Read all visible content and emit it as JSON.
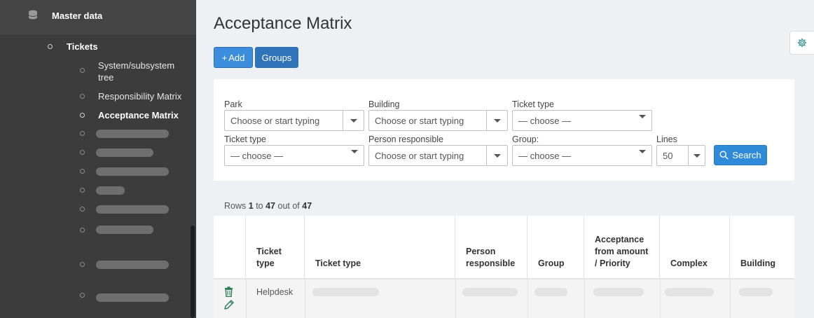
{
  "sidebar": {
    "section_title": "Master data",
    "tickets_label": "Tickets",
    "sub_items": [
      {
        "label": "System/subsystem tree",
        "active": false
      },
      {
        "label": "Responsibility Matrix",
        "active": false
      },
      {
        "label": "Acceptance Matrix",
        "active": true
      }
    ]
  },
  "page": {
    "title": "Acceptance Matrix"
  },
  "toolbar": {
    "add_label": "Add",
    "groups_label": "Groups"
  },
  "filters": {
    "park": {
      "label": "Park",
      "placeholder": "Choose or start typing"
    },
    "building": {
      "label": "Building",
      "placeholder": "Choose or start typing"
    },
    "ticket_type_1": {
      "label": "Ticket type",
      "value": "— choose —"
    },
    "ticket_type_2": {
      "label": "Ticket type",
      "value": "— choose —"
    },
    "person_responsible": {
      "label": "Person responsible",
      "placeholder": "Choose or start typing"
    },
    "group": {
      "label": "Group:",
      "value": "— choose —"
    },
    "lines": {
      "label": "Lines",
      "value": "50"
    },
    "search_label": "Search"
  },
  "rows_info": {
    "prefix": "Rows",
    "from": "1",
    "to_word": "to",
    "to": "47",
    "out_of_word": "out of",
    "total": "47"
  },
  "table": {
    "columns": [
      "Ticket type",
      "Ticket type",
      "Person responsible",
      "Group",
      "Acceptance from amount / Priority",
      "Complex",
      "Building"
    ],
    "rows": [
      {
        "ticket_type": "Helpdesk"
      }
    ]
  },
  "icons": {
    "sidebar_section": "database-icon",
    "add": "plus-icon",
    "search": "search-icon",
    "settings": "gear-icon",
    "row_delete": "trash-icon",
    "row_edit": "pencil-icon"
  },
  "colors": {
    "primary": "#3c8ddb",
    "sidebar_bg": "#3c3c3c",
    "row_action_icon": "#2f7d5b"
  }
}
